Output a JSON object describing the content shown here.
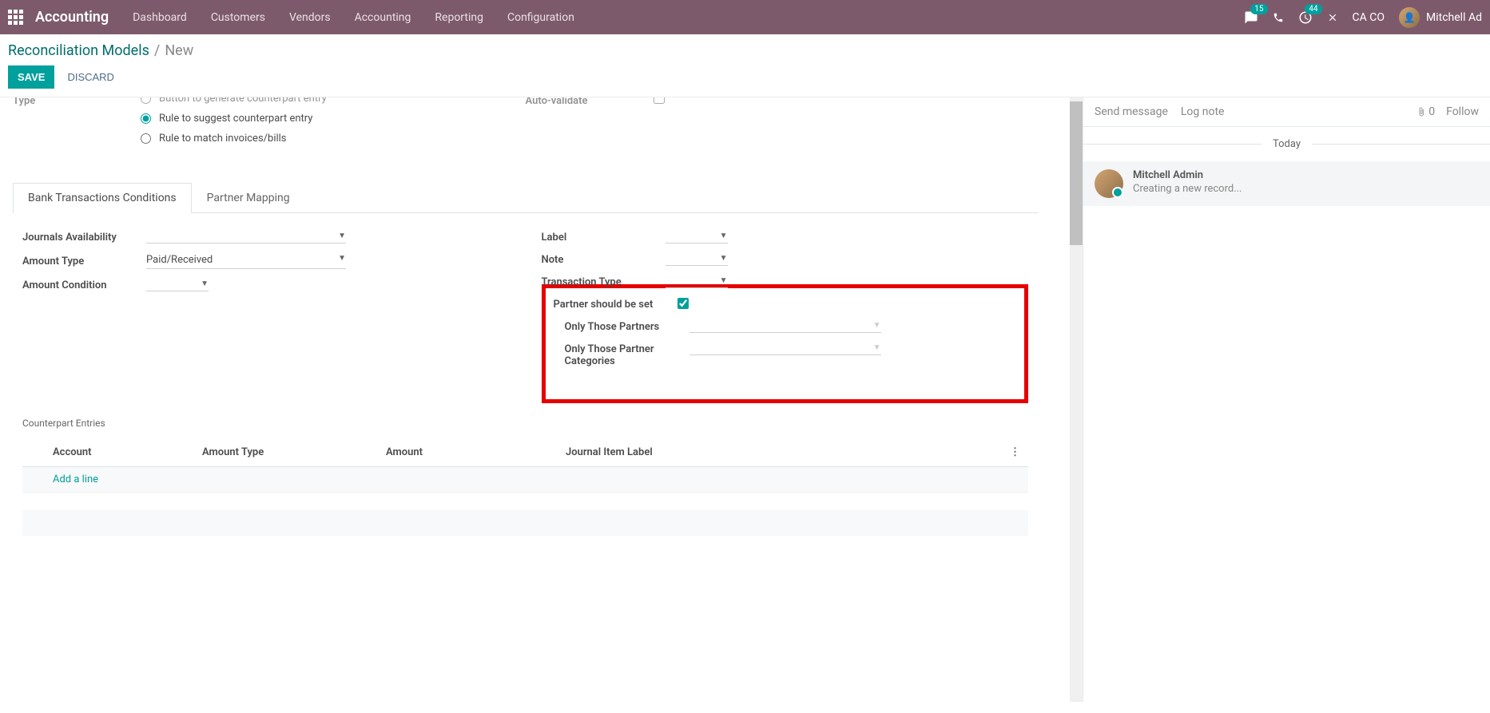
{
  "nav": {
    "brand": "Accounting",
    "items": [
      "Dashboard",
      "Customers",
      "Vendors",
      "Accounting",
      "Reporting",
      "Configuration"
    ],
    "messages_badge": "15",
    "activities_badge": "44",
    "company": "CA CO",
    "user": "Mitchell Ad"
  },
  "breadcrumb": {
    "link": "Reconciliation Models",
    "current": "New"
  },
  "actions": {
    "save": "SAVE",
    "discard": "DISCARD"
  },
  "form": {
    "type_label": "Type",
    "type_options": {
      "button": "Button to generate counterpart entry",
      "rule_suggest": "Rule to suggest counterpart entry",
      "rule_match": "Rule to match invoices/bills"
    },
    "auto_validate_label": "Auto-validate"
  },
  "tabs": {
    "bank": "Bank Transactions Conditions",
    "partner": "Partner Mapping"
  },
  "conditions": {
    "journals_label": "Journals Availability",
    "amount_type_label": "Amount Type",
    "amount_type_value": "Paid/Received",
    "amount_condition_label": "Amount Condition",
    "label_label": "Label",
    "note_label": "Note",
    "transaction_type_label": "Transaction Type",
    "partner_set_label": "Partner should be set",
    "only_partners_label": "Only Those Partners",
    "only_partner_categories_label": "Only Those Partner Categories"
  },
  "counterpart": {
    "header": "Counterpart Entries",
    "cols": {
      "account": "Account",
      "amount_type": "Amount Type",
      "amount": "Amount",
      "journal_label": "Journal Item Label"
    },
    "add_line": "Add a line"
  },
  "chat": {
    "send": "Send message",
    "log": "Log note",
    "attach_count": "0",
    "follow": "Follow",
    "today": "Today",
    "author": "Mitchell Admin",
    "text": "Creating a new record..."
  }
}
